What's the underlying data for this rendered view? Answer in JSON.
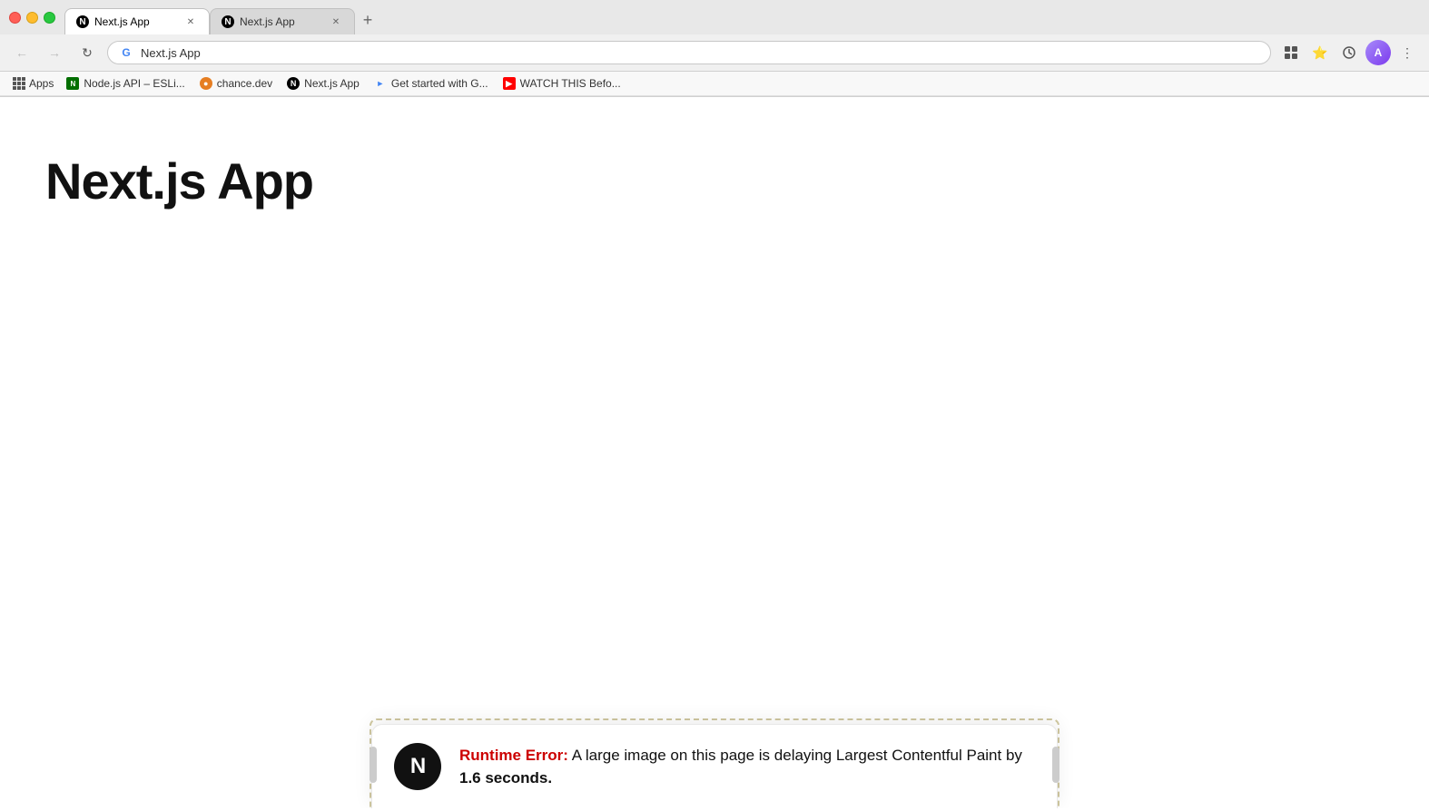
{
  "browser": {
    "tabs": [
      {
        "id": "tab1",
        "title": "Next.js App",
        "favicon_type": "nextjs-dark",
        "favicon_letter": "N",
        "active": true
      },
      {
        "id": "tab2",
        "title": "Next.js App",
        "favicon_type": "nextjs-dark",
        "favicon_letter": "N",
        "active": false
      }
    ],
    "new_tab_label": "+",
    "address": "Next.js App",
    "address_url": "Next.js App"
  },
  "bookmarks": {
    "apps_label": "Apps",
    "items": [
      {
        "id": "bm1",
        "title": "Node.js API – ESLi...",
        "favicon_type": "node",
        "favicon_label": "N"
      },
      {
        "id": "bm2",
        "title": "chance.dev",
        "favicon_type": "chance",
        "favicon_label": "c"
      },
      {
        "id": "bm3",
        "title": "Next.js App",
        "favicon_type": "nextjs",
        "favicon_label": "N"
      },
      {
        "id": "bm4",
        "title": "Get started with G...",
        "favicon_type": "gsuite",
        "favicon_label": "G"
      },
      {
        "id": "bm5",
        "title": "WATCH THIS Befo...",
        "favicon_type": "youtube",
        "favicon_label": "▶"
      }
    ]
  },
  "page": {
    "heading": "Next.js App"
  },
  "error": {
    "label": "Runtime Error:",
    "message": " A large image on this page is delaying Largest Contentful Paint by ",
    "bold_part": "1.6 seconds.",
    "icon_letter": "N"
  }
}
